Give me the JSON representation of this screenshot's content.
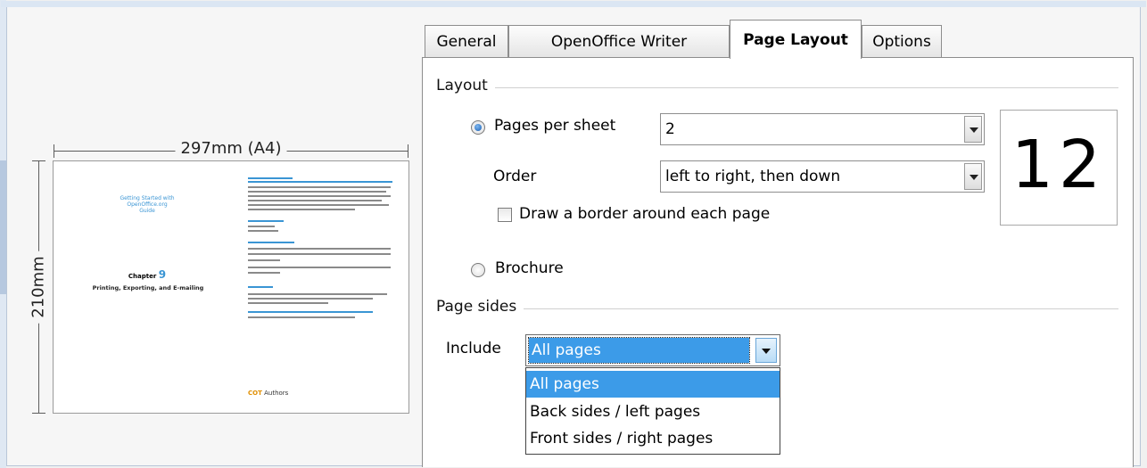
{
  "preview": {
    "width_label": "297mm (A4)",
    "height_label": "210mm",
    "page_title_lines": [
      "Getting Started with",
      "OpenOffice.org",
      "Guide"
    ],
    "chapter_word": "Chapter",
    "chapter_number": "9",
    "chapter_subtitle": "Printing, Exporting, and E-mailing",
    "footer_text": "Authors"
  },
  "tabs": [
    {
      "label": "General"
    },
    {
      "label": "OpenOffice Writer"
    },
    {
      "label": "Page Layout",
      "active": true
    },
    {
      "label": "Options"
    }
  ],
  "layout": {
    "section_title": "Layout",
    "pages_per_sheet_label": "Pages per sheet",
    "pages_per_sheet_value": "2",
    "pages_per_sheet_selected": true,
    "order_label": "Order",
    "order_value": "left to right, then down",
    "border_label": "Draw a border around each page",
    "border_checked": false,
    "brochure_label": "Brochure",
    "brochure_selected": false,
    "preview_digits": "12"
  },
  "page_sides": {
    "section_title": "Page sides",
    "include_label": "Include",
    "include_value": "All pages",
    "options": [
      "All pages",
      "Back sides / left pages",
      "Front sides / right pages"
    ],
    "selected_index": 0
  },
  "colors": {
    "accent": "#3c9be8",
    "link_blue": "#3a95d4"
  }
}
